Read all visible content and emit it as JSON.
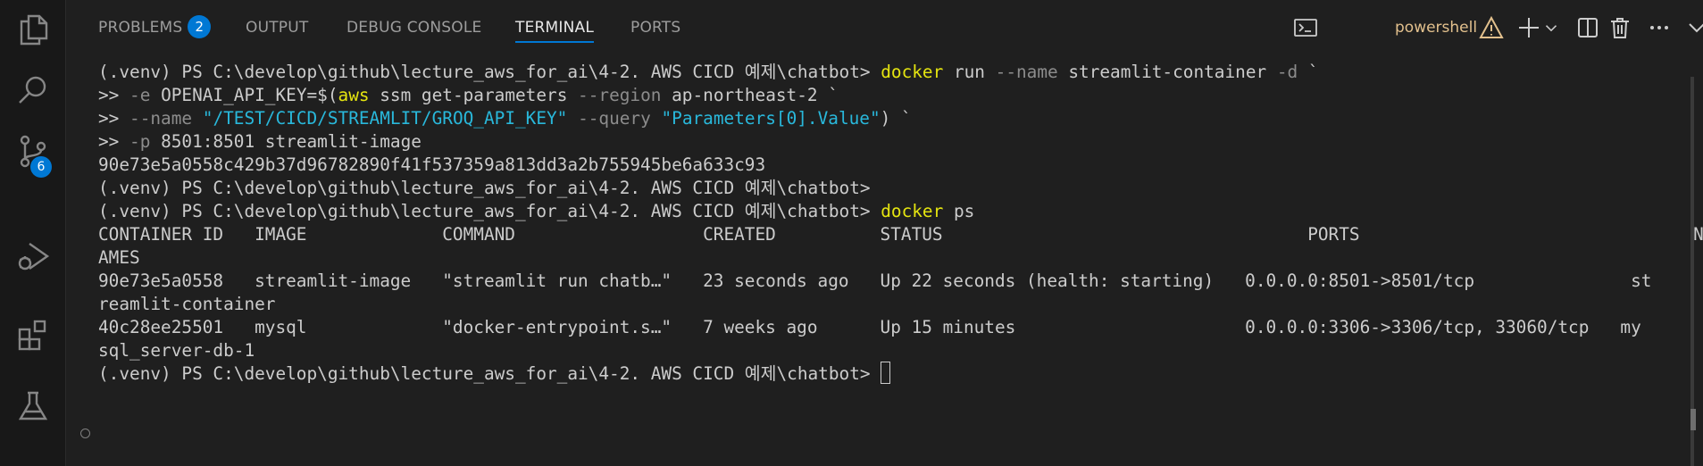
{
  "activity_bar": {
    "scm_badge": "6"
  },
  "panel": {
    "tabs": [
      {
        "label": "PROBLEMS",
        "badge": "2"
      },
      {
        "label": "OUTPUT"
      },
      {
        "label": "DEBUG CONSOLE"
      },
      {
        "label": "TERMINAL"
      },
      {
        "label": "PORTS"
      }
    ],
    "active_tab": "TERMINAL",
    "shell_name": "powershell"
  },
  "terminal": {
    "line1": {
      "prompt": "(.venv) PS C:\\develop\\github\\lecture_aws_for_ai\\4-2. AWS CICD 예제\\chatbot> ",
      "cmd": "docker",
      "rest_a": " run ",
      "flag": "--name",
      "rest_b": " streamlit-container ",
      "flag2": "-d",
      "tick": " `"
    },
    "line2": {
      "cont": ">> ",
      "flag": "-e",
      "text_a": " OPENAI_API_KEY=$(",
      "cmd": "aws",
      "text_b": " ssm get-parameters ",
      "flag2": "--region",
      "text_c": " ap-northeast-2 ",
      "tick": "`"
    },
    "line3": {
      "cont": ">> ",
      "flag": "--name",
      "sp1": " ",
      "str1": "\"/TEST/CICD/STREAMLIT/GROQ_API_KEY\"",
      "sp2": " ",
      "flag2": "--query",
      "sp3": " ",
      "str2": "\"Parameters[0].Value\"",
      "text": ") ",
      "tick": "`"
    },
    "line4": {
      "cont": ">> ",
      "flag": "-p",
      "text": " 8501:8501 streamlit-image"
    },
    "line5": "90e73e5a0558c429b37d96782890f41f537359a813dd3a2b755945be6a633c93",
    "line6": "(.venv) PS C:\\develop\\github\\lecture_aws_for_ai\\4-2. AWS CICD 예제\\chatbot>",
    "line7": {
      "prompt": "(.venv) PS C:\\develop\\github\\lecture_aws_for_ai\\4-2. AWS CICD 예제\\chatbot> ",
      "cmd": "docker",
      "rest": " ps"
    },
    "line8": "CONTAINER ID   IMAGE             COMMAND                  CREATED          STATUS                                   PORTS                                N",
    "line9": "AMES",
    "line10": "90e73e5a0558   streamlit-image   \"streamlit run chatb…\"   23 seconds ago   Up 22 seconds (health: starting)   0.0.0.0:8501->8501/tcp               st",
    "line11": "reamlit-container",
    "line12": "40c28ee25501   mysql             \"docker-entrypoint.s…\"   7 weeks ago      Up 15 minutes                      0.0.0.0:3306->3306/tcp, 33060/tcp   my",
    "line13": "sql_server-db-1",
    "line14": "(.venv) PS C:\\develop\\github\\lecture_aws_for_ai\\4-2. AWS CICD 예제\\chatbot> "
  },
  "colors": {
    "background": "#1f1f1f",
    "accent": "#0078d4",
    "command_yellow": "#e5e510",
    "string_cyan": "#29b8db",
    "flag_gray": "#8c8c8c",
    "warning": "#e2c08d"
  },
  "icons": [
    "files-icon",
    "search-icon",
    "source-control-icon",
    "run-debug-icon",
    "extensions-icon",
    "testing-icon",
    "terminal-icon",
    "warning-icon",
    "add-icon",
    "chevron-down-icon",
    "split-icon",
    "trash-icon",
    "more-icon",
    "close-icon"
  ]
}
